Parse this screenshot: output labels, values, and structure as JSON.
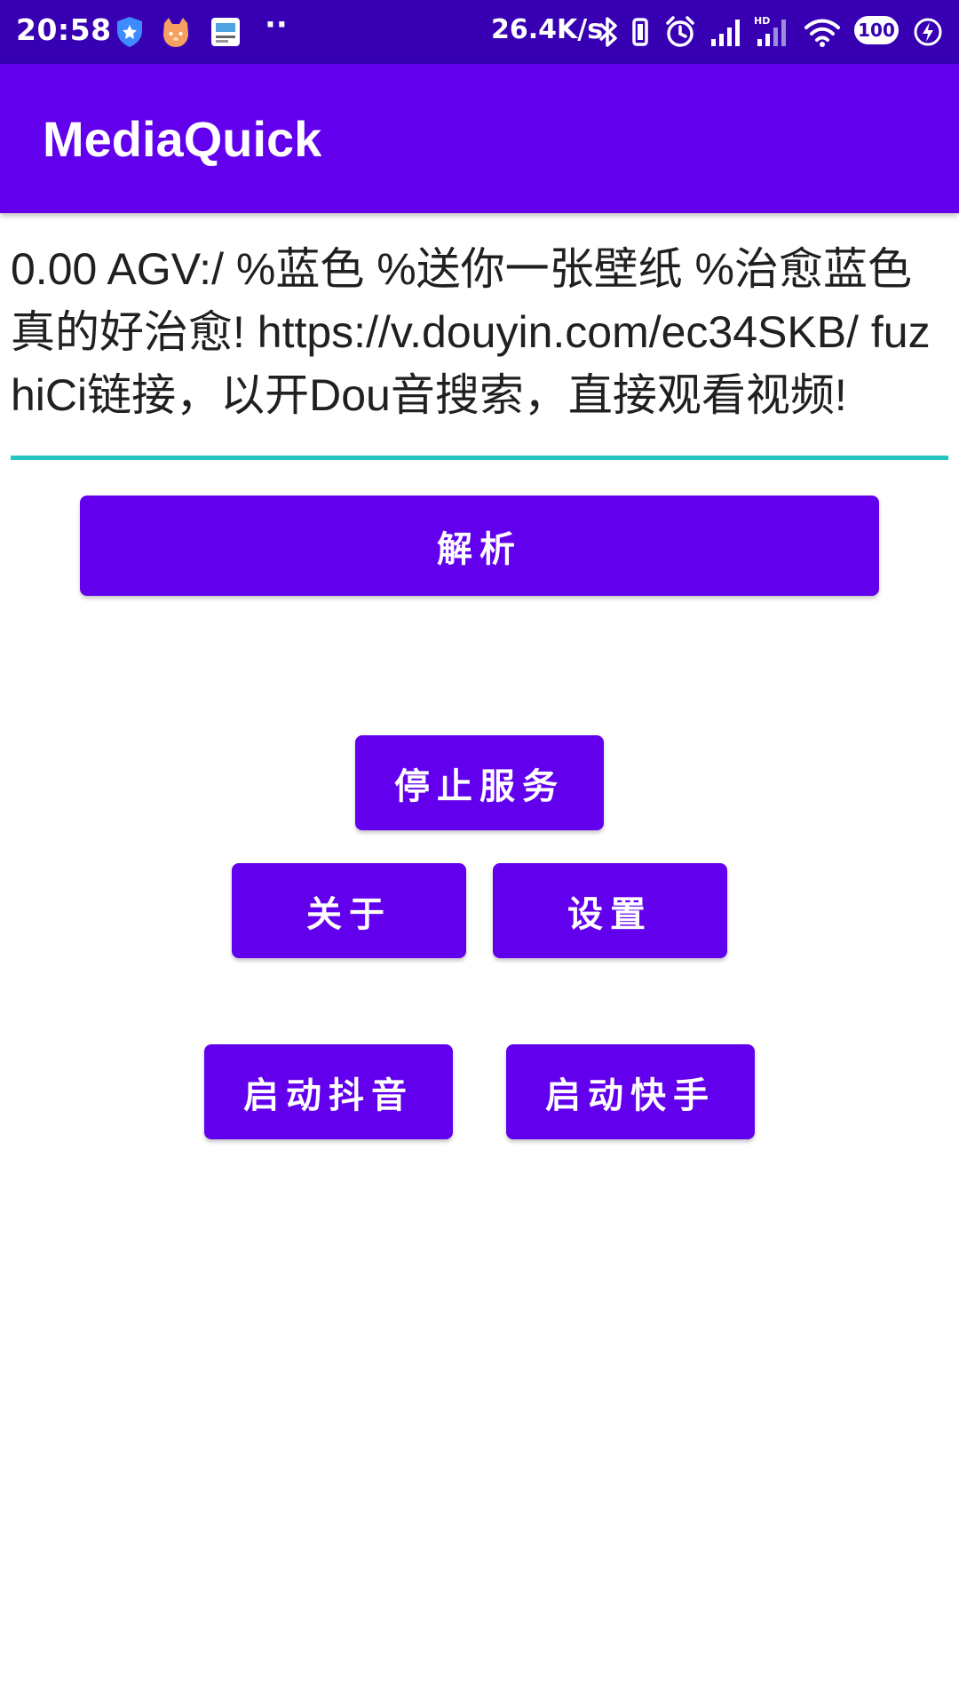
{
  "status_bar": {
    "time": "20:58",
    "more_indicator": "··",
    "network_speed": "26.4K/s",
    "battery_level": "100",
    "icons": [
      "shield-app-icon",
      "cat-app-icon",
      "mediaquick-app-icon",
      "bluetooth-icon",
      "vibrate-icon",
      "alarm-icon",
      "signal-icon",
      "signal-hd-icon",
      "wifi-icon",
      "battery-icon",
      "charging-icon"
    ]
  },
  "app_bar": {
    "title": "MediaQuick"
  },
  "link_input": {
    "value": "0.00 AGV:/ %蓝色 %送你一张壁纸 %治愈蓝色真的好治愈! https://v.douyin.com/ec34SKB/ fuzhiCi链接，以开Dou音搜索，直接观看视频!"
  },
  "buttons": {
    "parse": "解析",
    "stop_service": "停止服务",
    "about": "关于",
    "settings": "设置",
    "launch_douyin": "启动抖音",
    "launch_kuaishou": "启动快手"
  },
  "colors": {
    "status_bar": "#3700B3",
    "primary": "#6200EE",
    "input_underline": "#26C6C0"
  }
}
